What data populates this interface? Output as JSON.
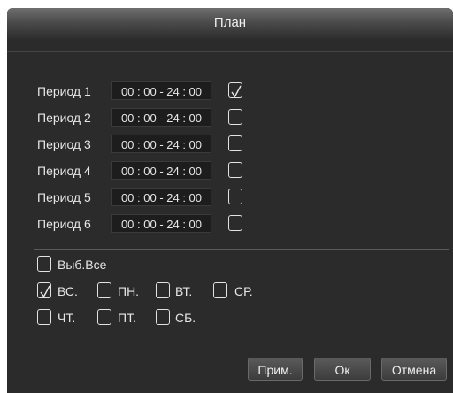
{
  "dialog": {
    "title": "План"
  },
  "periods": [
    {
      "label": "Период 1",
      "time": "00 : 00 - 24 : 00",
      "checked": true
    },
    {
      "label": "Период 2",
      "time": "00 : 00 - 24 : 00",
      "checked": false
    },
    {
      "label": "Период 3",
      "time": "00 : 00 - 24 : 00",
      "checked": false
    },
    {
      "label": "Период 4",
      "time": "00 : 00 - 24 : 00",
      "checked": false
    },
    {
      "label": "Период 5",
      "time": "00 : 00 - 24 : 00",
      "checked": false
    },
    {
      "label": "Период 6",
      "time": "00 : 00 - 24 : 00",
      "checked": false
    }
  ],
  "select_all": {
    "label": "Выб.Все",
    "checked": false
  },
  "days": [
    {
      "label": "ВС.",
      "checked": true
    },
    {
      "label": "ПН.",
      "checked": false
    },
    {
      "label": "ВТ.",
      "checked": false
    },
    {
      "label": "СР.",
      "checked": false
    },
    {
      "label": "ЧТ.",
      "checked": false
    },
    {
      "label": "ПТ.",
      "checked": false
    },
    {
      "label": "СБ.",
      "checked": false
    }
  ],
  "buttons": {
    "apply": "Прим.",
    "ok": "Ок",
    "cancel": "Отмена"
  },
  "icons": {
    "check": "checkmark-icon"
  },
  "colors": {
    "background": "#2b2b2b",
    "text": "#e6e6e6",
    "field": "#1d1d1d"
  }
}
